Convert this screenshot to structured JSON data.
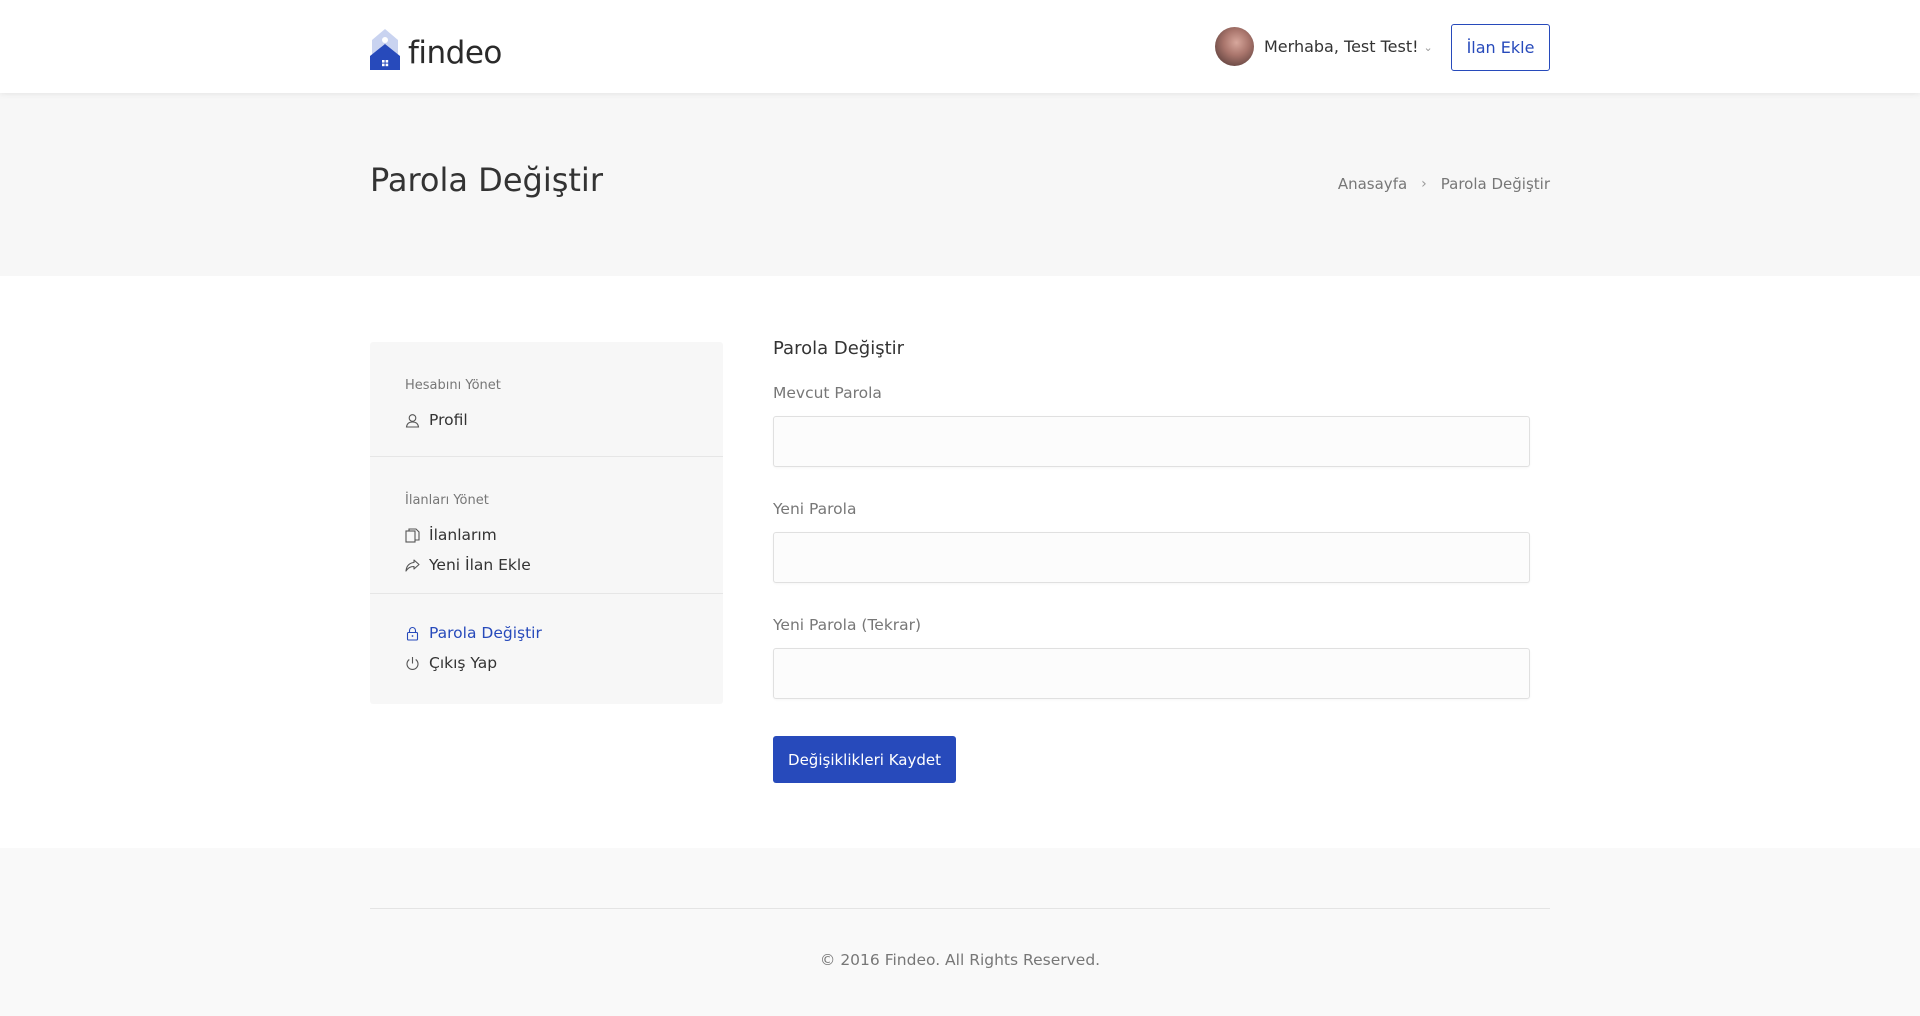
{
  "brand": {
    "name": "findeo",
    "accent": "#274abb"
  },
  "header": {
    "greeting": "Merhaba, Test Test!",
    "add_listing_label": "İlan Ekle"
  },
  "titlebar": {
    "title": "Parola Değiştir",
    "breadcrumb": [
      "Anasayfa",
      "Parola Değiştir"
    ]
  },
  "sidebar": {
    "sections": [
      {
        "heading": "Hesabını Yönet",
        "items": [
          {
            "label": "Profil",
            "icon": "user-icon"
          }
        ]
      },
      {
        "heading": "İlanları Yönet",
        "items": [
          {
            "label": "İlanlarım",
            "icon": "documents-icon"
          },
          {
            "label": "Yeni İlan Ekle",
            "icon": "share-arrow-icon"
          }
        ]
      },
      {
        "heading": "",
        "items": [
          {
            "label": "Parola Değiştir",
            "icon": "lock-icon",
            "active": true
          },
          {
            "label": "Çıkış Yap",
            "icon": "power-icon"
          }
        ]
      }
    ]
  },
  "form": {
    "title": "Parola Değiştir",
    "fields": [
      {
        "label": "Mevcut Parola",
        "value": ""
      },
      {
        "label": "Yeni Parola",
        "value": ""
      },
      {
        "label": "Yeni Parola (Tekrar)",
        "value": ""
      }
    ],
    "submit_label": "Değişiklikleri Kaydet"
  },
  "footer": {
    "copyright": "© 2016 Findeo. All Rights Reserved."
  }
}
